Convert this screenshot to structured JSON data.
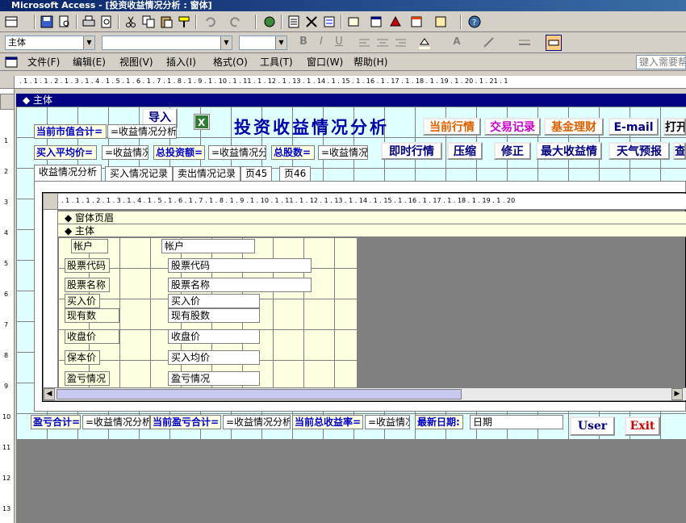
{
  "window": {
    "title": "Microsoft Access - [投资收益情况分析 : 窗体]"
  },
  "toolbar_format": {
    "object_combo": "主体",
    "font_combo": "",
    "size_combo": ""
  },
  "menu": {
    "items": [
      "文件(F)",
      "编辑(E)",
      "视图(V)",
      "插入(I)",
      "格式(O)",
      "工具(T)",
      "窗口(W)",
      "帮助(H)"
    ],
    "help_placeholder": "键入需要帮助"
  },
  "ruler": {
    "top": ". 1 . 1 . 1 . 2 . 1 . 3 . 1 . 4 . 1 . 5 . 1 . 6 . 1 . 7 . 1 . 8 . 1 . 9 . 1 . 10 . 1 . 11 . 1 . 12 . 1 . 13 . 1 . 14 . 1 . 15 . 1 . 16 . 1 . 17 . 1 . 18 . 1 . 19 . 1 . 20 . 1 . 21 . 1",
    "sub": ". 1 . 1 . 1 . 2 . 1 . 3 . 1 . 4 . 1 . 5 . 1 . 6 . 1 . 7 . 1 . 8 . 1 . 9 . 1 . 10 . 1 . 11 . 1 . 12 . 1 . 13 . 1 . 14 . 1 . 15 . 1 . 16 . 1 . 17 . 1 . 18 . 1 . 19 . 1 . 20",
    "left_marks": [
      "1",
      "2",
      "3",
      "4",
      "5",
      "6",
      "7",
      "8",
      "9",
      "10",
      "11",
      "12",
      "13"
    ]
  },
  "section": {
    "main": "主体",
    "sub_header": "窗体页眉",
    "sub_main": "主体"
  },
  "form": {
    "title": "投资收益情况分析",
    "import_btn": "导入",
    "market_value_label": "当前市值合计=",
    "market_value_field": "=收益情况分析!",
    "avg_buy_label": "买入平均价=",
    "avg_buy_field": "=收益情况",
    "total_invest_label": "总投资额=",
    "total_invest_field": "=收益情况分",
    "total_shares_label": "总股数=",
    "total_shares_field": "=收益情况:",
    "buttons_row1": [
      "当前行情",
      "交易记录",
      "基金理财",
      "E-mail",
      "打开"
    ],
    "buttons_row2": [
      "即时行情",
      "压缩",
      "修正",
      "最大收益情",
      "天气预报",
      "查"
    ],
    "tabs": [
      "收益情况分析",
      "买入情况记录",
      "卖出情况记录",
      "页45",
      "页46"
    ],
    "profit_total_label": "盈亏合计=",
    "profit_total_field": "=收益情况分析!",
    "cur_profit_label": "当前盈亏合计=",
    "cur_profit_field": "=收益情况分析",
    "cur_rate_label": "当前总收益率=",
    "cur_rate_field": "=收益情况",
    "latest_date_label": "最新日期:",
    "latest_date_field": "日期",
    "user_btn": "User",
    "exit_btn": "Exit"
  },
  "subform": {
    "rows": [
      {
        "label": "帐户",
        "field": "帐户"
      },
      {
        "label": "股票代码",
        "field": "股票代码"
      },
      {
        "label": "股票名称",
        "field": "股票名称"
      },
      {
        "label": "买入价",
        "field": "买入价"
      },
      {
        "label": "现有数",
        "field": "现有股数"
      },
      {
        "label": "收盘价",
        "field": "收盘价"
      },
      {
        "label": "保本价",
        "field": "买入均价"
      },
      {
        "label": "盈亏情况",
        "field": "盈亏情况"
      }
    ]
  },
  "colors": {
    "accent": "#000080",
    "grid_bg": "#ffffe1",
    "form_bg": "#e0ffff"
  }
}
